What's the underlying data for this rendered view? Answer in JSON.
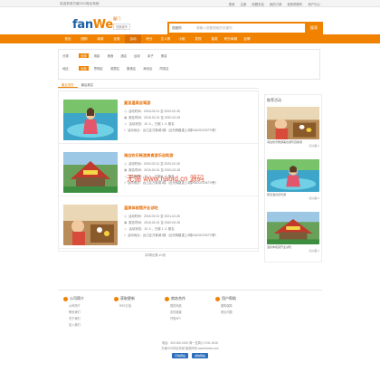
{
  "topbar": {
    "left": "欢迎来到方维O2O商业系统",
    "links": [
      "登录",
      "注册",
      "收藏本站",
      "我的订单",
      "我的购物车",
      "商户中心"
    ]
  },
  "header": {
    "logo_main": "fan",
    "logo_accent": "We",
    "city": "厦门",
    "switch_city": "切换城市",
    "search_select": "搜团购",
    "search_placeholder": "请输入您要搜索的关键词",
    "search_button": "搜索"
  },
  "nav": {
    "items": [
      "首页",
      "团购",
      "商家",
      "优惠",
      "活动",
      "积分",
      "达人秀",
      "小组",
      "发现",
      "抽奖",
      "积分商城",
      "品牌"
    ],
    "active_index": 4
  },
  "filters": {
    "row1_label": "分类:",
    "row1_options": [
      "全部",
      "电影",
      "美食",
      "酒店",
      "运动",
      "亲子",
      "美容"
    ],
    "row2_label": "地区:",
    "row2_options": [
      "全部",
      "思明区",
      "湖里区",
      "集美区",
      "海沧区",
      "同安区"
    ]
  },
  "tabs": {
    "items": [
      "最近发布",
      "最后报名"
    ],
    "active_index": 0
  },
  "cards": [
    {
      "title": "夏至温泉自驾游",
      "time_label": "活动时间",
      "time": "2015-02-01 至 2020-02-26",
      "signup_label": "报名时间",
      "signup": "2015-02-01 至 2020-02-26",
      "status_label": "活动状态",
      "status": "10 人，已报 1 人 报名",
      "addr_label": "活动地点",
      "addr": "台江区万象城1楼（近光明路重上3楼KAGOOOKTV旁）"
    },
    {
      "title": "海边欢乐畅游美食游乐自助游",
      "time_label": "活动时间",
      "time": "2015-02-01 至 2020-02-26",
      "signup_label": "报名时间",
      "signup": "2015-02-01 至 2020-02-26",
      "status_label": "活动状态",
      "status": "10 人，已报 1 人 报名",
      "addr_label": "活动地点",
      "addr": "台江区万象城1楼（近光明路重上3楼KAGOOOKTV旁）"
    },
    {
      "title": "温泉体验馆开业试吃",
      "time_label": "活动时间",
      "time": "2015-02-01 至 2021-02-26",
      "signup_label": "报名时间",
      "signup": "2015-02-01 至 2020-02-26",
      "status_label": "活动状态",
      "status": "10 人，已报 1 人 报名",
      "addr_label": "活动地点",
      "addr": "台江区万象城1楼（近光明路重上3楼KAGOOOKTV旁）"
    }
  ],
  "pager": "共3条记录 1/1页",
  "side": {
    "title": "推荐活动",
    "items": [
      {
        "caption": "海边欢乐畅游美食游乐自助游",
        "count": "感兴趣 2"
      },
      {
        "caption": "夏至温泉自驾游",
        "count": "感兴趣 2"
      },
      {
        "caption": "温泉体验馆开业试吃",
        "count": "感兴趣 1"
      }
    ]
  },
  "watermark": "无锡 www.haoid.cn 源码",
  "footer_cols": [
    {
      "title": "公司简介",
      "links": [
        "公司简介",
        "联系我们",
        "关于我们",
        "加入我们"
      ]
    },
    {
      "title": "获取更新",
      "links": [
        "RSS订阅"
      ]
    },
    {
      "title": "商务合作",
      "links": [
        "提供商品",
        "友情链接",
        "开放API"
      ]
    },
    {
      "title": "用户帮助",
      "links": [
        "团购保障",
        "常见问题"
      ]
    }
  ],
  "footer": {
    "line1": "电话：400-000-0000 周一至周六 9:00-18:00",
    "line2": "方维O2O商业系统 版权所有 www.fanwe.com",
    "badges": [
      "可信网站",
      "诚信网站"
    ]
  }
}
